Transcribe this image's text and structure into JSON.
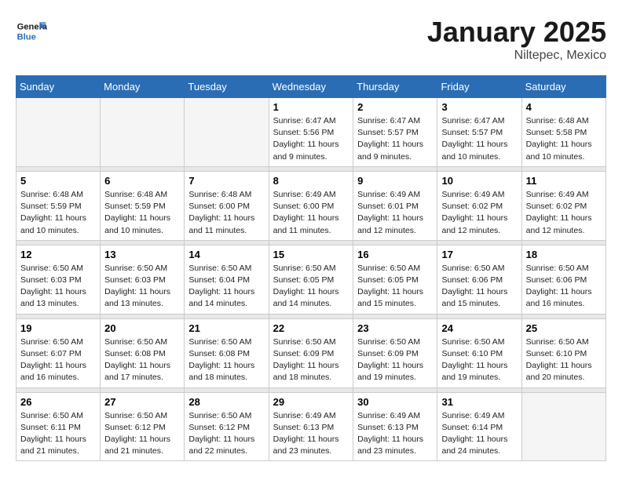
{
  "header": {
    "logo_general": "General",
    "logo_blue": "Blue",
    "month_title": "January 2025",
    "location": "Niltepec, Mexico"
  },
  "weekdays": [
    "Sunday",
    "Monday",
    "Tuesday",
    "Wednesday",
    "Thursday",
    "Friday",
    "Saturday"
  ],
  "weeks": [
    {
      "days": [
        {
          "num": "",
          "empty": true
        },
        {
          "num": "",
          "empty": true
        },
        {
          "num": "",
          "empty": true
        },
        {
          "num": "1",
          "sunrise": "6:47 AM",
          "sunset": "5:56 PM",
          "daylight": "11 hours and 9 minutes."
        },
        {
          "num": "2",
          "sunrise": "6:47 AM",
          "sunset": "5:57 PM",
          "daylight": "11 hours and 9 minutes."
        },
        {
          "num": "3",
          "sunrise": "6:47 AM",
          "sunset": "5:57 PM",
          "daylight": "11 hours and 10 minutes."
        },
        {
          "num": "4",
          "sunrise": "6:48 AM",
          "sunset": "5:58 PM",
          "daylight": "11 hours and 10 minutes."
        }
      ]
    },
    {
      "days": [
        {
          "num": "5",
          "sunrise": "6:48 AM",
          "sunset": "5:59 PM",
          "daylight": "11 hours and 10 minutes."
        },
        {
          "num": "6",
          "sunrise": "6:48 AM",
          "sunset": "5:59 PM",
          "daylight": "11 hours and 10 minutes."
        },
        {
          "num": "7",
          "sunrise": "6:48 AM",
          "sunset": "6:00 PM",
          "daylight": "11 hours and 11 minutes."
        },
        {
          "num": "8",
          "sunrise": "6:49 AM",
          "sunset": "6:00 PM",
          "daylight": "11 hours and 11 minutes."
        },
        {
          "num": "9",
          "sunrise": "6:49 AM",
          "sunset": "6:01 PM",
          "daylight": "11 hours and 12 minutes."
        },
        {
          "num": "10",
          "sunrise": "6:49 AM",
          "sunset": "6:02 PM",
          "daylight": "11 hours and 12 minutes."
        },
        {
          "num": "11",
          "sunrise": "6:49 AM",
          "sunset": "6:02 PM",
          "daylight": "11 hours and 12 minutes."
        }
      ]
    },
    {
      "days": [
        {
          "num": "12",
          "sunrise": "6:50 AM",
          "sunset": "6:03 PM",
          "daylight": "11 hours and 13 minutes."
        },
        {
          "num": "13",
          "sunrise": "6:50 AM",
          "sunset": "6:03 PM",
          "daylight": "11 hours and 13 minutes."
        },
        {
          "num": "14",
          "sunrise": "6:50 AM",
          "sunset": "6:04 PM",
          "daylight": "11 hours and 14 minutes."
        },
        {
          "num": "15",
          "sunrise": "6:50 AM",
          "sunset": "6:05 PM",
          "daylight": "11 hours and 14 minutes."
        },
        {
          "num": "16",
          "sunrise": "6:50 AM",
          "sunset": "6:05 PM",
          "daylight": "11 hours and 15 minutes."
        },
        {
          "num": "17",
          "sunrise": "6:50 AM",
          "sunset": "6:06 PM",
          "daylight": "11 hours and 15 minutes."
        },
        {
          "num": "18",
          "sunrise": "6:50 AM",
          "sunset": "6:06 PM",
          "daylight": "11 hours and 16 minutes."
        }
      ]
    },
    {
      "days": [
        {
          "num": "19",
          "sunrise": "6:50 AM",
          "sunset": "6:07 PM",
          "daylight": "11 hours and 16 minutes."
        },
        {
          "num": "20",
          "sunrise": "6:50 AM",
          "sunset": "6:08 PM",
          "daylight": "11 hours and 17 minutes."
        },
        {
          "num": "21",
          "sunrise": "6:50 AM",
          "sunset": "6:08 PM",
          "daylight": "11 hours and 18 minutes."
        },
        {
          "num": "22",
          "sunrise": "6:50 AM",
          "sunset": "6:09 PM",
          "daylight": "11 hours and 18 minutes."
        },
        {
          "num": "23",
          "sunrise": "6:50 AM",
          "sunset": "6:09 PM",
          "daylight": "11 hours and 19 minutes."
        },
        {
          "num": "24",
          "sunrise": "6:50 AM",
          "sunset": "6:10 PM",
          "daylight": "11 hours and 19 minutes."
        },
        {
          "num": "25",
          "sunrise": "6:50 AM",
          "sunset": "6:10 PM",
          "daylight": "11 hours and 20 minutes."
        }
      ]
    },
    {
      "days": [
        {
          "num": "26",
          "sunrise": "6:50 AM",
          "sunset": "6:11 PM",
          "daylight": "11 hours and 21 minutes."
        },
        {
          "num": "27",
          "sunrise": "6:50 AM",
          "sunset": "6:12 PM",
          "daylight": "11 hours and 21 minutes."
        },
        {
          "num": "28",
          "sunrise": "6:50 AM",
          "sunset": "6:12 PM",
          "daylight": "11 hours and 22 minutes."
        },
        {
          "num": "29",
          "sunrise": "6:49 AM",
          "sunset": "6:13 PM",
          "daylight": "11 hours and 23 minutes."
        },
        {
          "num": "30",
          "sunrise": "6:49 AM",
          "sunset": "6:13 PM",
          "daylight": "11 hours and 23 minutes."
        },
        {
          "num": "31",
          "sunrise": "6:49 AM",
          "sunset": "6:14 PM",
          "daylight": "11 hours and 24 minutes."
        },
        {
          "num": "",
          "empty": true
        }
      ]
    }
  ]
}
